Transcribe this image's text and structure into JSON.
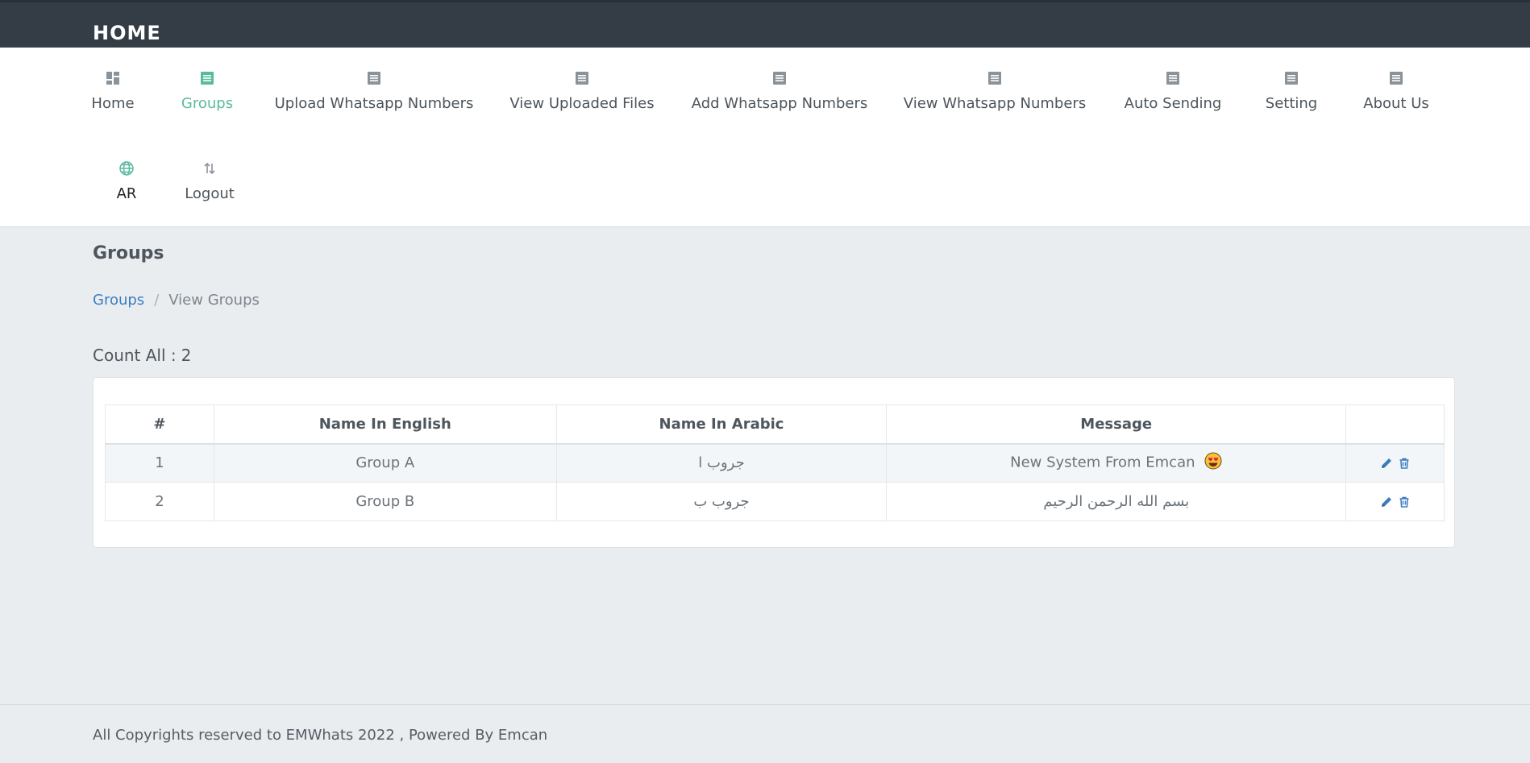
{
  "header": {
    "brand": "HOME"
  },
  "nav": {
    "items": [
      {
        "label": "Home",
        "icon": "dashboard-icon"
      },
      {
        "label": "Groups",
        "icon": "list-icon",
        "active": true
      },
      {
        "label": "Upload Whatsapp Numbers",
        "icon": "list-icon"
      },
      {
        "label": "View Uploaded Files",
        "icon": "list-icon"
      },
      {
        "label": "Add Whatsapp Numbers",
        "icon": "list-icon"
      },
      {
        "label": "View Whatsapp Numbers",
        "icon": "list-icon"
      },
      {
        "label": "Auto Sending",
        "icon": "list-icon"
      },
      {
        "label": "Setting",
        "icon": "list-icon"
      },
      {
        "label": "About Us",
        "icon": "list-icon"
      },
      {
        "label": "AR",
        "icon": "globe-icon"
      },
      {
        "label": "Logout",
        "icon": "swap-icon"
      }
    ]
  },
  "page": {
    "title": "Groups",
    "breadcrumb": {
      "link": "Groups",
      "separator": "/",
      "current": "View Groups"
    },
    "count_label": "Count All :",
    "count_value": "2"
  },
  "table": {
    "headers": [
      "#",
      "Name In English",
      "Name In Arabic",
      "Message",
      ""
    ],
    "rows": [
      {
        "idx": "1",
        "name_en": "Group A",
        "name_ar": "جروب ا",
        "message": "New System From Emcan"
      },
      {
        "idx": "2",
        "name_en": "Group B",
        "name_ar": "جروب ب",
        "message": "بسم الله الرحمن الرحيم"
      }
    ]
  },
  "footer": {
    "text": "All Copyrights reserved to EMWhats 2022 , Powered By Emcan"
  },
  "colors": {
    "topbar": "#343c45",
    "accent": "#5aba9f",
    "link": "#3b7dc0",
    "background": "#e9edf0"
  }
}
